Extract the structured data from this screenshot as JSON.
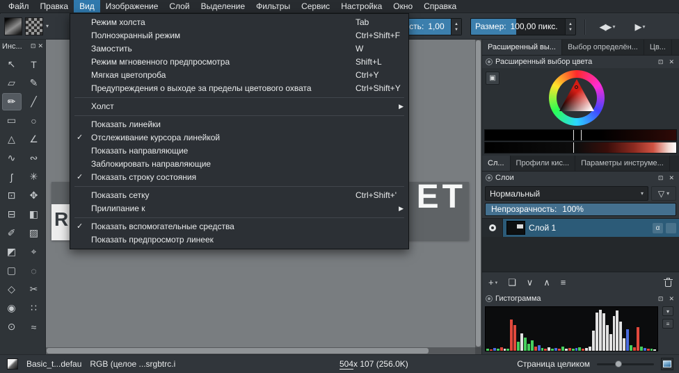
{
  "icons": {
    "check": "✓",
    "submenu_arrow": "▶",
    "caret_down": "▾",
    "spin_up": "▲",
    "spin_down": "▼",
    "float": "⊡",
    "close": "✕",
    "mirror_h": "◀▶",
    "mirror_v": "▶",
    "funnel": "▽",
    "plus": "+",
    "duplicate": "❏",
    "arrow_down": "∨",
    "arrow_up": "∧",
    "properties": "≡",
    "alpha": "α",
    "shape_selector": "▣",
    "list": "≡"
  },
  "menubar": {
    "items": [
      "Файл",
      "Правка",
      "Вид",
      "Изображение",
      "Слой",
      "Выделение",
      "Фильтры",
      "Сервис",
      "Настройка",
      "Окно",
      "Справка"
    ],
    "active_index": 2
  },
  "toolbar": {
    "opacity_spin": {
      "label": "Непрозрачность:",
      "value": "1,00"
    },
    "size_spin": {
      "label": "Размер:",
      "value": "100,00 пикс."
    }
  },
  "view_menu": {
    "items": [
      {
        "label": "Режим холста",
        "shortcut": "Tab"
      },
      {
        "label": "Полноэкранный режим",
        "shortcut": "Ctrl+Shift+F"
      },
      {
        "label": "Замостить",
        "shortcut": "W"
      },
      {
        "label": "Режим мгновенного предпросмотра",
        "shortcut": "Shift+L"
      },
      {
        "label": "Мягкая цветопроба",
        "shortcut": "Ctrl+Y"
      },
      {
        "label": "Предупреждения о выходе за пределы цветового охвата",
        "shortcut": "Ctrl+Shift+Y"
      },
      {
        "separator": true
      },
      {
        "label": "Холст",
        "submenu": true
      },
      {
        "separator": true
      },
      {
        "label": "Показать линейки"
      },
      {
        "label": "Отслеживание курсора линейкой",
        "checked": true
      },
      {
        "label": "Показать направляющие"
      },
      {
        "label": "Заблокировать направляющие"
      },
      {
        "label": "Показать строку состояния",
        "checked": true
      },
      {
        "separator": true
      },
      {
        "label": "Показать сетку",
        "shortcut": "Ctrl+Shift+'"
      },
      {
        "label": "Прилипание к",
        "submenu": true
      },
      {
        "separator": true
      },
      {
        "label": "Показать вспомогательные средства",
        "checked": true
      },
      {
        "label": "Показать предпросмотр линеек"
      }
    ]
  },
  "toolbox": {
    "header": "Инс...",
    "tools": [
      {
        "name": "select-shapes",
        "glyph": "↖"
      },
      {
        "name": "text",
        "glyph": "T"
      },
      {
        "name": "edit-shapes",
        "glyph": "▱"
      },
      {
        "name": "calligraphy",
        "glyph": "✎"
      },
      {
        "name": "freehand-brush",
        "glyph": "✏",
        "selected": true
      },
      {
        "name": "line",
        "glyph": "╱"
      },
      {
        "name": "rectangle",
        "glyph": "▭"
      },
      {
        "name": "ellipse",
        "glyph": "○"
      },
      {
        "name": "polygon",
        "glyph": "△"
      },
      {
        "name": "polyline",
        "glyph": "∠"
      },
      {
        "name": "bezier-curve",
        "glyph": "∿"
      },
      {
        "name": "freehand-path",
        "glyph": "∾"
      },
      {
        "name": "dynamic-brush",
        "glyph": "ʃ"
      },
      {
        "name": "multibrush",
        "glyph": "✳"
      },
      {
        "name": "transform",
        "glyph": "⊡"
      },
      {
        "name": "move",
        "glyph": "✥"
      },
      {
        "name": "crop",
        "glyph": "⊟"
      },
      {
        "name": "gradient",
        "glyph": "◧"
      },
      {
        "name": "color-sampler",
        "glyph": "✐"
      },
      {
        "name": "pattern-edit",
        "glyph": "▨"
      },
      {
        "name": "fill",
        "glyph": "◩"
      },
      {
        "name": "assistants",
        "glyph": "⌖"
      },
      {
        "name": "rect-select",
        "glyph": "▢"
      },
      {
        "name": "ellipse-select",
        "glyph": "◌"
      },
      {
        "name": "polygon-select",
        "glyph": "◇"
      },
      {
        "name": "freehand-select",
        "glyph": "✂"
      },
      {
        "name": "contiguous-select",
        "glyph": "◉"
      },
      {
        "name": "similar-select",
        "glyph": "∷"
      },
      {
        "name": "bezier-select",
        "glyph": "⊙"
      },
      {
        "name": "magnetic-select",
        "glyph": "≈"
      }
    ]
  },
  "canvas": {
    "doc_text_left": "RE",
    "doc_text_right": "ET"
  },
  "right_panel": {
    "top_tabs": [
      {
        "label": "Расширенный вы...",
        "active": true
      },
      {
        "label": "Выбор определён..."
      },
      {
        "label": "Цв..."
      }
    ],
    "color_docker": {
      "title": "Расширенный выбор цвета"
    },
    "mid_tabs": [
      {
        "label": "Сл...",
        "active": true
      },
      {
        "label": "Профили кис..."
      },
      {
        "label": "Параметры инструме..."
      }
    ],
    "layers_docker": {
      "title": "Слои",
      "blend_mode": "Нормальный",
      "opacity_label": "Непрозрачность:",
      "opacity_value": "100%",
      "layers": [
        {
          "name": "Слой 1",
          "selected": true
        }
      ]
    },
    "histogram_docker": {
      "title": "Гистограмма",
      "colors": {
        "r": "#e2493d",
        "g": "#47cf5e",
        "b": "#4a6ce0",
        "w": "#e2e2e2"
      },
      "bars": [
        [
          5,
          "g"
        ],
        [
          3,
          "r"
        ],
        [
          6,
          "b"
        ],
        [
          4,
          "g"
        ],
        [
          8,
          "r"
        ],
        [
          5,
          "w"
        ],
        [
          4,
          "g"
        ],
        [
          72,
          "r"
        ],
        [
          58,
          "r"
        ],
        [
          20,
          "g"
        ],
        [
          40,
          "w"
        ],
        [
          30,
          "g"
        ],
        [
          16,
          "g"
        ],
        [
          24,
          "g"
        ],
        [
          9,
          "r"
        ],
        [
          12,
          "b"
        ],
        [
          7,
          "g"
        ],
        [
          5,
          "r"
        ],
        [
          8,
          "w"
        ],
        [
          5,
          "g"
        ],
        [
          7,
          "b"
        ],
        [
          4,
          "r"
        ],
        [
          9,
          "g"
        ],
        [
          5,
          "w"
        ],
        [
          7,
          "r"
        ],
        [
          4,
          "g"
        ],
        [
          6,
          "b"
        ],
        [
          8,
          "g"
        ],
        [
          4,
          "r"
        ],
        [
          6,
          "w"
        ],
        [
          10,
          "w"
        ],
        [
          46,
          "w"
        ],
        [
          88,
          "w"
        ],
        [
          94,
          "w"
        ],
        [
          86,
          "w"
        ],
        [
          58,
          "w"
        ],
        [
          38,
          "w"
        ],
        [
          80,
          "w"
        ],
        [
          92,
          "w"
        ],
        [
          66,
          "w"
        ],
        [
          28,
          "w"
        ],
        [
          50,
          "b"
        ],
        [
          12,
          "g"
        ],
        [
          8,
          "r"
        ],
        [
          54,
          "r"
        ],
        [
          10,
          "g"
        ],
        [
          7,
          "b"
        ],
        [
          5,
          "r"
        ],
        [
          4,
          "g"
        ],
        [
          3,
          "w"
        ]
      ]
    }
  },
  "statusbar": {
    "preset": "Basic_t...defau",
    "colorspace": "RGB (целое ...srgbtrc.i",
    "dims": "504",
    "dims_rest": " x 107 (256.0K)",
    "zoom_mode": "Страница целиком"
  }
}
